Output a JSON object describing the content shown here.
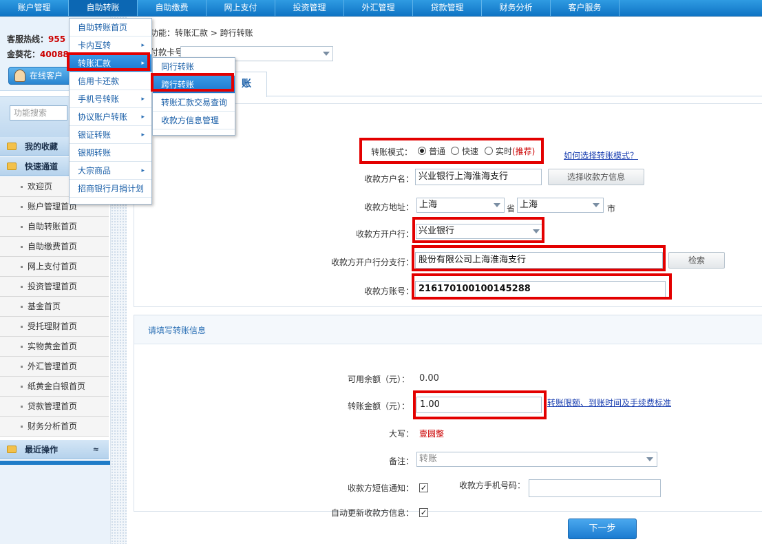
{
  "topnav": [
    "账户管理",
    "自助转账",
    "自助缴费",
    "网上支付",
    "投资管理",
    "外汇管理",
    "贷款管理",
    "财务分析",
    "客户服务"
  ],
  "left": {
    "hotline_label": "客服热线：",
    "hotline_num": "955",
    "jinkuihua_label": "金葵花：",
    "jinkuihua_num": "40088",
    "online_btn": "在线客户",
    "search_placeholder": "功能搜索",
    "favorites": "我的收藏",
    "quick_channel": "快速通道",
    "quick_items": [
      "欢迎页",
      "账户管理首页",
      "自助转账首页",
      "自助缴费首页",
      "网上支付首页",
      "投资管理首页",
      "基金首页",
      "受托理财首页",
      "实物黄金首页",
      "外汇管理首页",
      "纸黄金白银首页",
      "贷款管理首页",
      "财务分析首页"
    ],
    "recent_ops": "最近操作",
    "collapse_symbol": "≈"
  },
  "main": {
    "crumb": "功能：转账汇款 > 跨行转账",
    "card_label": "付款卡号：",
    "tab_label": "跨行转账",
    "tab_visible_text": "账"
  },
  "form": {
    "mode_label": "转账模式：",
    "mode_options": [
      "普通",
      "快速",
      "实时"
    ],
    "mode_recommend": "(推荐)",
    "mode_selected": "普通",
    "mode_help_link": "如何选择转账模式？",
    "payee_name_label": "收款方户名：",
    "payee_name": "兴业银行上海淮海支行",
    "select_payee_btn": "选择收款方信息",
    "address_label": "收款方地址：",
    "province": "上海",
    "province_suffix": "省",
    "city": "上海",
    "city_suffix": "市",
    "bank_label": "收款方开户行：",
    "bank": "兴业银行",
    "branch_label": "收款方开户行分支行：",
    "branch": "股份有限公司上海淮海支行",
    "search_btn": "检索",
    "account_label": "收款方账号：",
    "account": "216170100100145288"
  },
  "transfer": {
    "section_title": "请填写转账信息",
    "balance_label": "可用余额（元）：",
    "balance": "0.00",
    "amount_label": "转账金额（元）：",
    "amount": "1.00",
    "limit_link": "转账限额、到账时间及手续费标准",
    "uppercase_label": "大写：",
    "uppercase": "壹圆整",
    "remark_label": "备注：",
    "remark": "转账",
    "sms_label": "收款方短信通知：",
    "sms_checked": "✓",
    "phone_label": "收款方手机号码：",
    "phone": "",
    "auto_update_label": "自动更新收款方信息：",
    "auto_update_checked": "✓",
    "next_btn": "下一步"
  },
  "dropdown1": {
    "items": [
      {
        "label": "自助转账首页",
        "caret": ""
      },
      {
        "label": "卡内互转",
        "caret": "▸"
      },
      {
        "label": "转账汇款",
        "caret": "▸"
      },
      {
        "label": "信用卡还款",
        "caret": ""
      },
      {
        "label": "手机号转账",
        "caret": "▸"
      },
      {
        "label": "协议账户转账",
        "caret": "▸"
      },
      {
        "label": "银证转账",
        "caret": "▸"
      },
      {
        "label": "银期转账",
        "caret": ""
      },
      {
        "label": "大宗商品",
        "caret": "▸"
      },
      {
        "label": "招商银行月捐计划",
        "caret": ""
      }
    ],
    "active_index": 2
  },
  "dropdown2": {
    "items": [
      "同行转账",
      "跨行转账",
      "转账汇款交易查询",
      "收款方信息管理"
    ],
    "active_index": 1
  },
  "colors": {
    "accent": "#1c78cf",
    "highlight_box": "#e30000",
    "link": "#1a3fb0",
    "recommend": "#cc0000"
  }
}
